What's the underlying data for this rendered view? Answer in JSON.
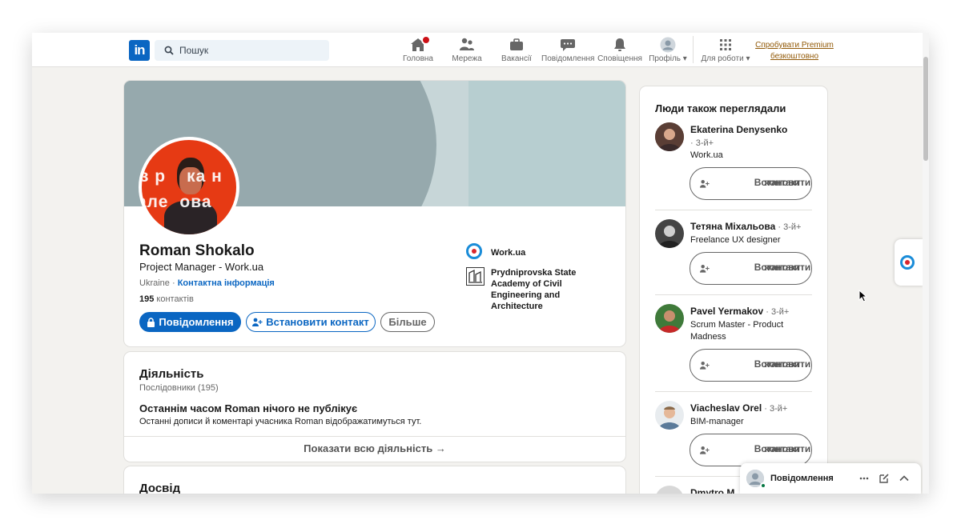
{
  "nav": {
    "logo": "in",
    "search_placeholder": "Пошук",
    "items": [
      {
        "label": "Головна"
      },
      {
        "label": "Мережа"
      },
      {
        "label": "Вакансії"
      },
      {
        "label": "Повідомлення"
      },
      {
        "label": "Сповіщення"
      },
      {
        "label": "Профіль"
      },
      {
        "label": "Для роботи"
      }
    ],
    "premium_line1": "Спробувати Premium",
    "premium_line2": "безкоштовно"
  },
  "profile": {
    "name": "Roman Shokalo",
    "headline": "Project Manager - Work.ua",
    "location": "Ukraine",
    "separator": " · ",
    "contact_info": "Контактна інформація",
    "connections_count": "195",
    "connections_label": " контактів",
    "avatar_text_1": "з р",
    "avatar_text_2": "ка н",
    "avatar_text_3": "але",
    "avatar_text_4": "ова",
    "buttons": {
      "message": "Повідомлення",
      "connect": "Встановити контакт",
      "more": "Більше"
    },
    "orgs": [
      {
        "name": "Work.ua"
      },
      {
        "name_line1": "Prydniprovska State",
        "name_line2": "Academy of Civil",
        "name_line3": "Engineering and",
        "name_line4": "Architecture"
      }
    ]
  },
  "activity": {
    "title": "Діяльність",
    "followers": "Послідовники (195)",
    "empty_title": "Останнім часом Roman нічого не публікує",
    "empty_text": "Останні дописи й коментарі учасника Roman відображатимуться тут.",
    "show_all": "Показати всю діяльність →"
  },
  "experience": {
    "title": "Досвід"
  },
  "sidebar": {
    "title": "Люди також переглядали",
    "connect_line1": "Встановити",
    "connect_line2": "контакт",
    "people": [
      {
        "name": "Ekaterina Denysenko",
        "degree": "· 3-й+",
        "line1": "Work.ua",
        "line2": ""
      },
      {
        "name": "Тетяна Міхальова",
        "degree": " · 3-й+",
        "line1": "Freelance UX designer",
        "line2": ""
      },
      {
        "name": "Pavel Yermakov",
        "degree": " · 3-й+",
        "line1": "Scrum Master - Product",
        "line2": "Madness"
      },
      {
        "name": "Viacheslav Orel",
        "degree": " · 3-й+",
        "line1": "BIM-manager",
        "line2": ""
      },
      {
        "name": "Dmytro M",
        "degree": "",
        "line1": "",
        "line2": ""
      }
    ]
  },
  "messaging": {
    "title": "Повідомлення"
  },
  "colors": {
    "brand": "#0a66c2",
    "badge": "#cc1016",
    "premium": "#915907",
    "online": "#057642"
  }
}
